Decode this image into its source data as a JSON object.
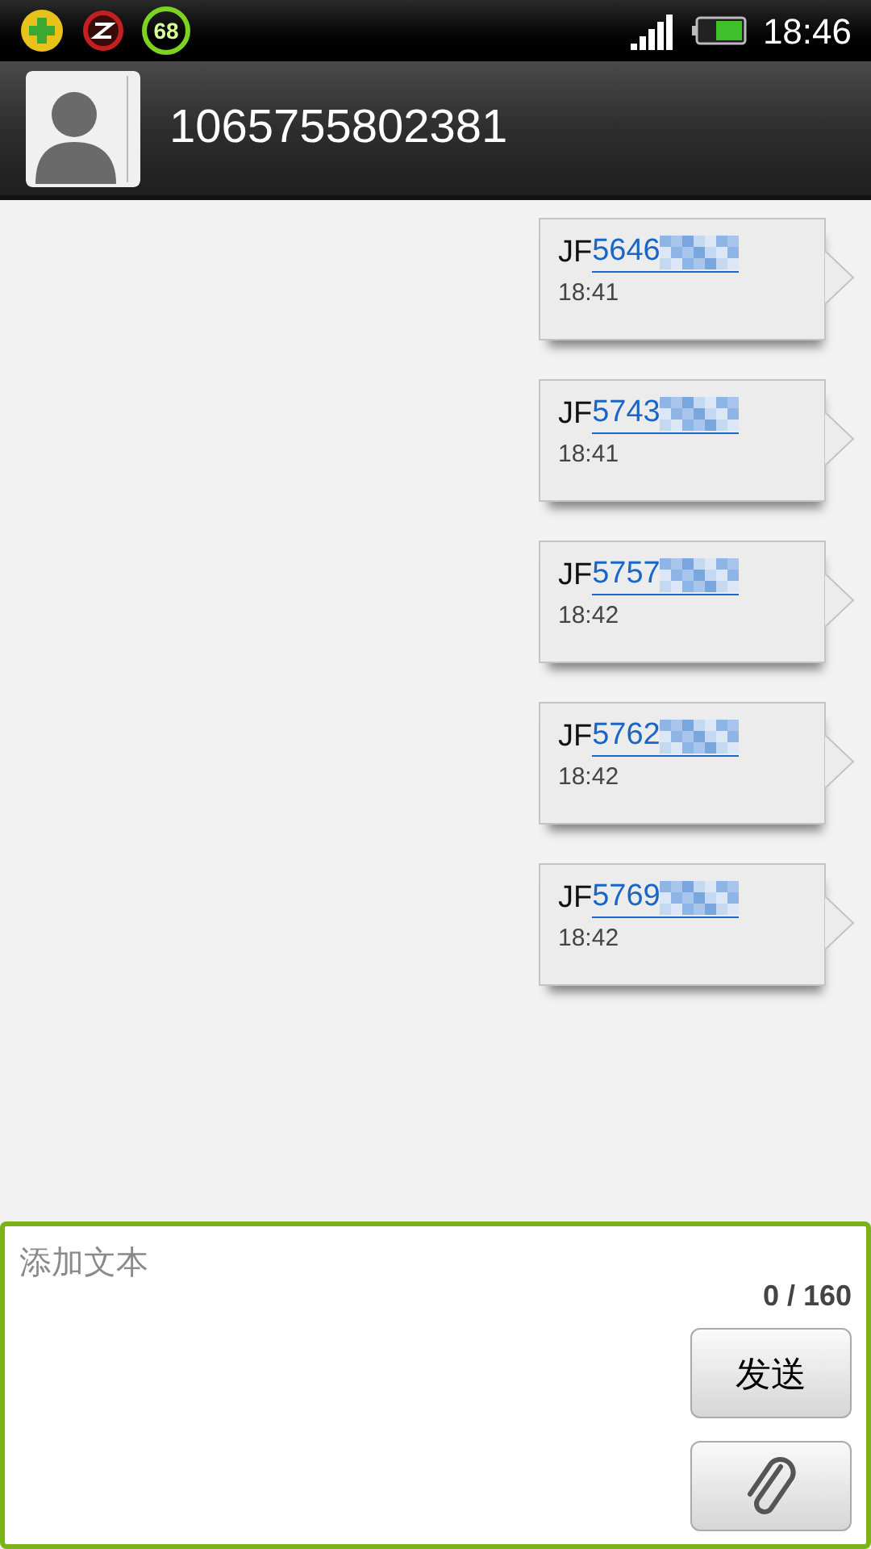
{
  "status_bar": {
    "badge_number": "68",
    "time": "18:46"
  },
  "header": {
    "contact_number": "1065755802381"
  },
  "messages": [
    {
      "prefix": "JF",
      "link": "5646",
      "time": "18:41"
    },
    {
      "prefix": "JF",
      "link": "5743",
      "time": "18:41"
    },
    {
      "prefix": "JF",
      "link": "5757",
      "time": "18:42"
    },
    {
      "prefix": "JF",
      "link": "5762",
      "time": "18:42"
    },
    {
      "prefix": "JF",
      "link": "5769",
      "time": "18:42"
    }
  ],
  "composer": {
    "placeholder": "添加文本",
    "counter": "0 / 160",
    "send_button": "发送"
  }
}
